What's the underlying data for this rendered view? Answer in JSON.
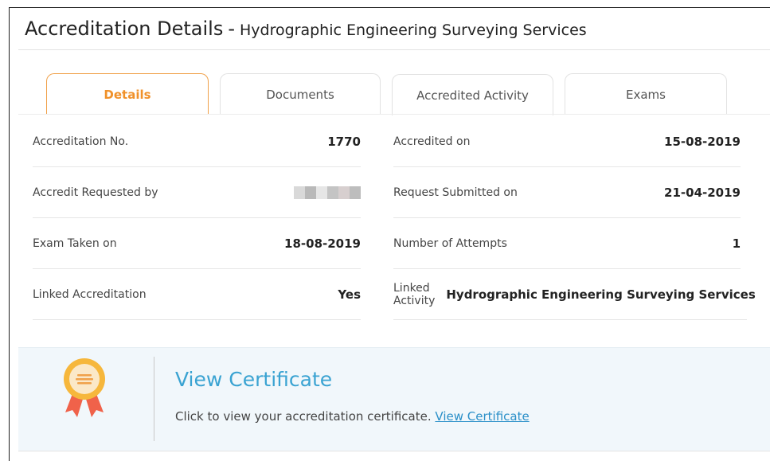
{
  "header": {
    "title": "Accreditation Details",
    "separator": "-",
    "subtitle": "Hydrographic Engineering Surveying Services"
  },
  "tabs": [
    {
      "label": "Details",
      "active": true
    },
    {
      "label": "Documents",
      "active": false
    },
    {
      "label": "Accredited Activity",
      "active": false
    },
    {
      "label": "Exams",
      "active": false
    }
  ],
  "details": {
    "left": [
      {
        "label": "Accreditation No.",
        "value": "1770"
      },
      {
        "label": "Accredit Requested by",
        "value": ""
      },
      {
        "label": "Exam Taken on",
        "value": "18-08-2019"
      },
      {
        "label": "Linked Accreditation",
        "value": "Yes"
      }
    ],
    "right": [
      {
        "label": "Accredited on",
        "value": "15-08-2019"
      },
      {
        "label": "Request Submitted on",
        "value": "21-04-2019"
      },
      {
        "label": "Number of Attempts",
        "value": "1"
      },
      {
        "label": "Linked Activity",
        "value": "Hydrographic Engineering Surveying Services"
      }
    ]
  },
  "certificate": {
    "title": "View Certificate",
    "description": "Click to view your accreditation certificate.",
    "link_label": "View Certificate",
    "icon": "award-ribbon-icon"
  },
  "colors": {
    "accent_orange": "#f0912a",
    "link_blue": "#2a8fc8",
    "panel_bg": "#f1f7fb"
  }
}
